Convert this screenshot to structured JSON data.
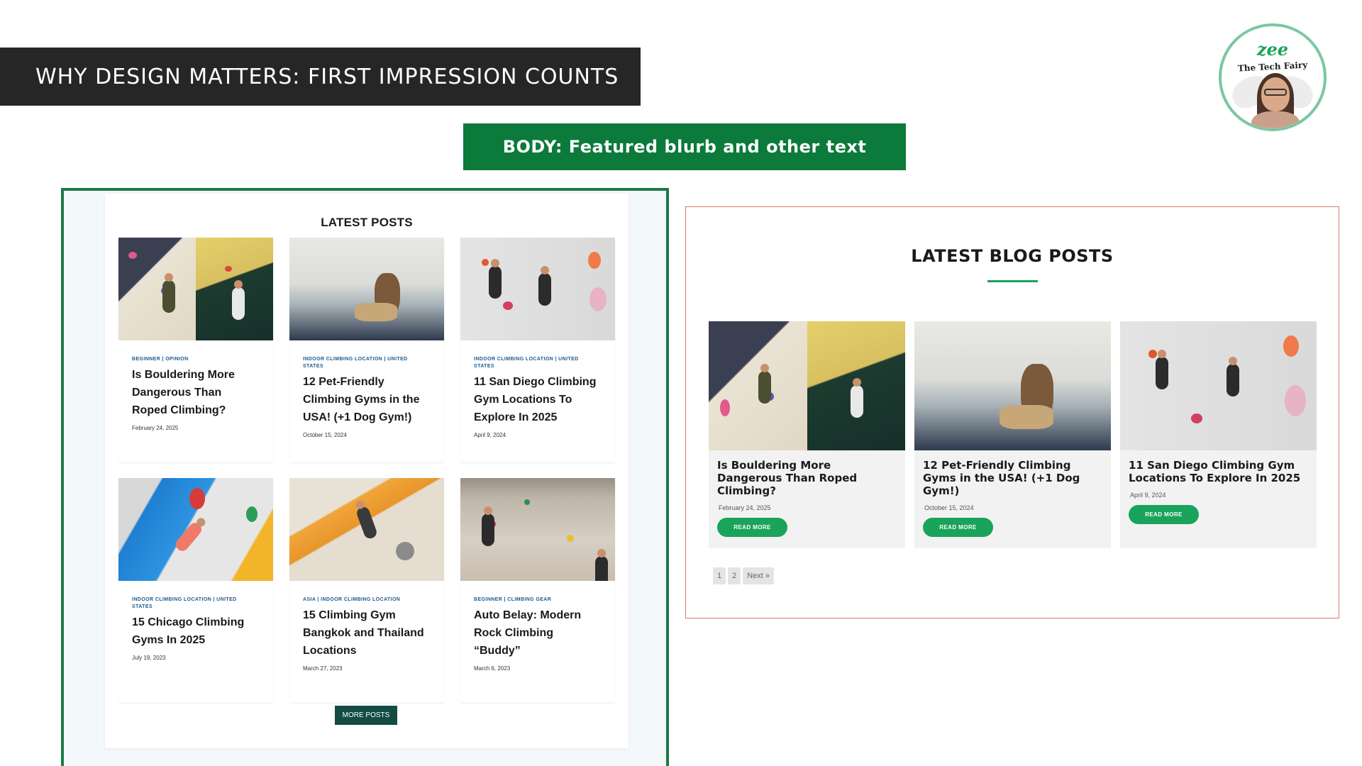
{
  "slide": {
    "title": "WHY DESIGN MATTERS: FIRST IMPRESSION COUNTS",
    "section_label": "BODY: Featured blurb and other text"
  },
  "badge": {
    "script_text": "zee",
    "name_text": "The Tech Fairy"
  },
  "left_panel": {
    "heading": "LATEST POSTS",
    "more_posts_label": "MORE POSTS",
    "posts": [
      {
        "category": "BEGINNER | OPINION",
        "title": "Is Bouldering More Dangerous Than Roped Climbing?",
        "date": "February 24, 2025"
      },
      {
        "category": "INDOOR CLIMBING LOCATION | UNITED STATES",
        "title": "12 Pet-Friendly Climbing Gyms in the USA! (+1 Dog Gym!)",
        "date": "October 15, 2024"
      },
      {
        "category": "INDOOR CLIMBING LOCATION | UNITED STATES",
        "title": "11 San Diego Climbing Gym Locations To Explore In 2025",
        "date": "April 9, 2024"
      },
      {
        "category": "INDOOR CLIMBING LOCATION | UNITED STATES",
        "title": "15 Chicago Climbing Gyms In 2025",
        "date": "July 19, 2023"
      },
      {
        "category": "ASIA | INDOOR CLIMBING LOCATION",
        "title": "15 Climbing Gym Bangkok and Thailand Locations",
        "date": "March 27, 2023"
      },
      {
        "category": "BEGINNER | CLIMBING GEAR",
        "title": "Auto Belay: Modern Rock Climbing “Buddy”",
        "date": "March 6, 2023"
      }
    ]
  },
  "right_panel": {
    "heading": "LATEST BLOG POSTS",
    "read_more_label": "READ MORE",
    "posts": [
      {
        "title": "Is Bouldering More Dangerous Than Roped Climbing?",
        "date": "February 24, 2025"
      },
      {
        "title": "12 Pet-Friendly Climbing Gyms in the USA! (+1 Dog Gym!)",
        "date": "October 15, 2024"
      },
      {
        "title": "11 San Diego Climbing Gym Locations To Explore In 2025",
        "date": "April 9, 2024"
      }
    ],
    "pagination": [
      "1",
      "2",
      "Next »"
    ]
  },
  "colors": {
    "title_bar": "#262626",
    "accent_green": "#1aa35a",
    "section_green": "#0b7a3a",
    "frame_green": "#1d7a45",
    "frame_red": "#d8786a",
    "more_posts_bg": "#124c45",
    "category_blue": "#1e5a8c"
  }
}
